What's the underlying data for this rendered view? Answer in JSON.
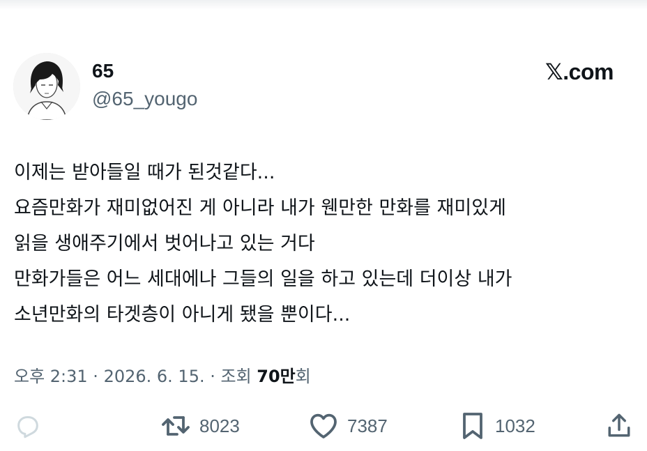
{
  "author": {
    "display_name": "65",
    "handle": "@65_yougo"
  },
  "brand": "𝕏.com",
  "tweet": {
    "lines": [
      "이제는 받아들일 때가 된것같다...",
      "요즘만화가 재미없어진 게 아니라 내가 웬만한 만화를 재미있게",
      "읽을 생애주기에서 벗어나고 있는 거다",
      "만화가들은 어느 세대에나 그들의 일을 하고 있는데 더이상 내가",
      "소년만화의 타겟층이 아니게 됐을 뿐이다..."
    ]
  },
  "meta": {
    "prefix": "오후 2:31 · 2026. 6. 15. · 조회 ",
    "views": "70만",
    "suffix": "회"
  },
  "actions": {
    "reply_icon": "reply-icon",
    "retweet_count": "8023",
    "like_count": "7387",
    "bookmark_count": "1032",
    "share_icon": "share-icon"
  },
  "colors": {
    "text": "#0f1419",
    "muted": "#536471",
    "reply_icon": "#cfd9de"
  }
}
